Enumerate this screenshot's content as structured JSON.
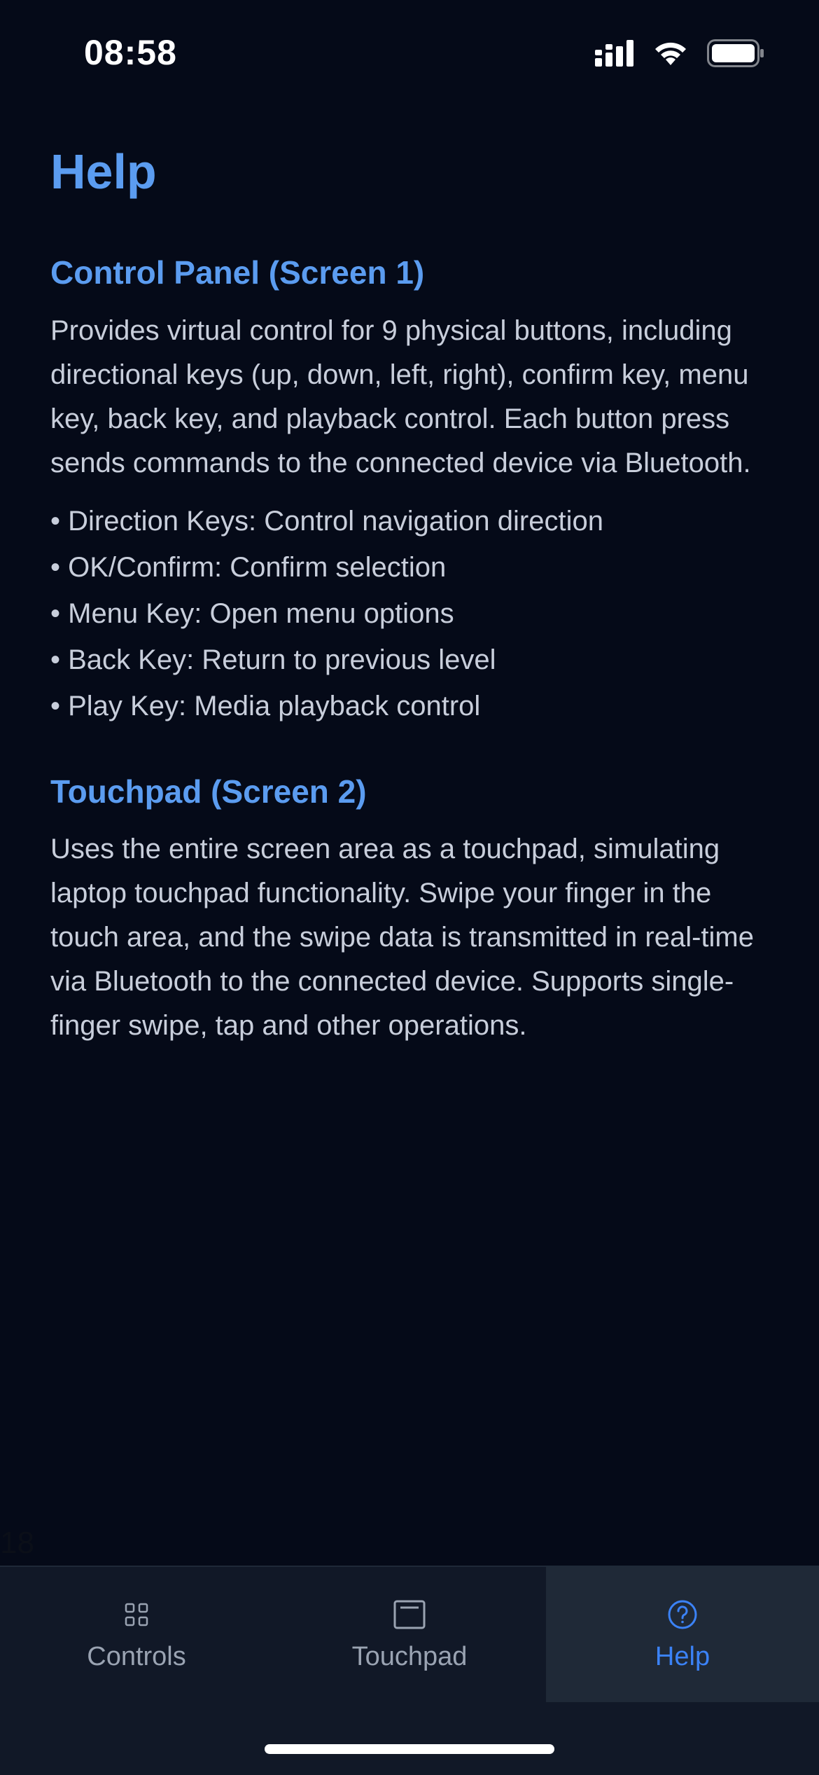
{
  "colors": {
    "background": "#050a18",
    "accent": "#5b9cf0",
    "accent_strong": "#3b82f6",
    "tab_bar": "#111827",
    "tab_active_bg": "#1f2937"
  },
  "status_bar": {
    "time": "08:58",
    "icons": [
      "signal-icon",
      "wifi-icon",
      "battery-icon"
    ]
  },
  "page": {
    "title": "Help"
  },
  "sections": [
    {
      "title": "Control Panel (Screen 1)",
      "body": "Provides virtual control for 9 physical buttons, including directional keys (up, down, left, right), confirm key, menu key, back key, and playback control. Each button press sends commands to the connected device via Bluetooth.",
      "bullets": [
        "• Direction Keys: Control navigation direction",
        "• OK/Confirm: Confirm selection",
        "• Menu Key: Open menu options",
        "• Back Key: Return to previous level",
        "• Play Key: Media playback control"
      ]
    },
    {
      "title": "Touchpad (Screen 2)",
      "body": "Uses the entire screen area as a touchpad, simulating laptop touchpad functionality. Swipe your finger in the touch area, and the swipe data is transmitted in real-time via Bluetooth to the connected device. Supports single-finger swipe, tap and other operations."
    }
  ],
  "stray_text": "18",
  "tabs": [
    {
      "label": "Controls",
      "icon": "grid-icon",
      "active": false
    },
    {
      "label": "Touchpad",
      "icon": "touchpad-icon",
      "active": false
    },
    {
      "label": "Help",
      "icon": "help-circle-icon",
      "active": true
    }
  ]
}
